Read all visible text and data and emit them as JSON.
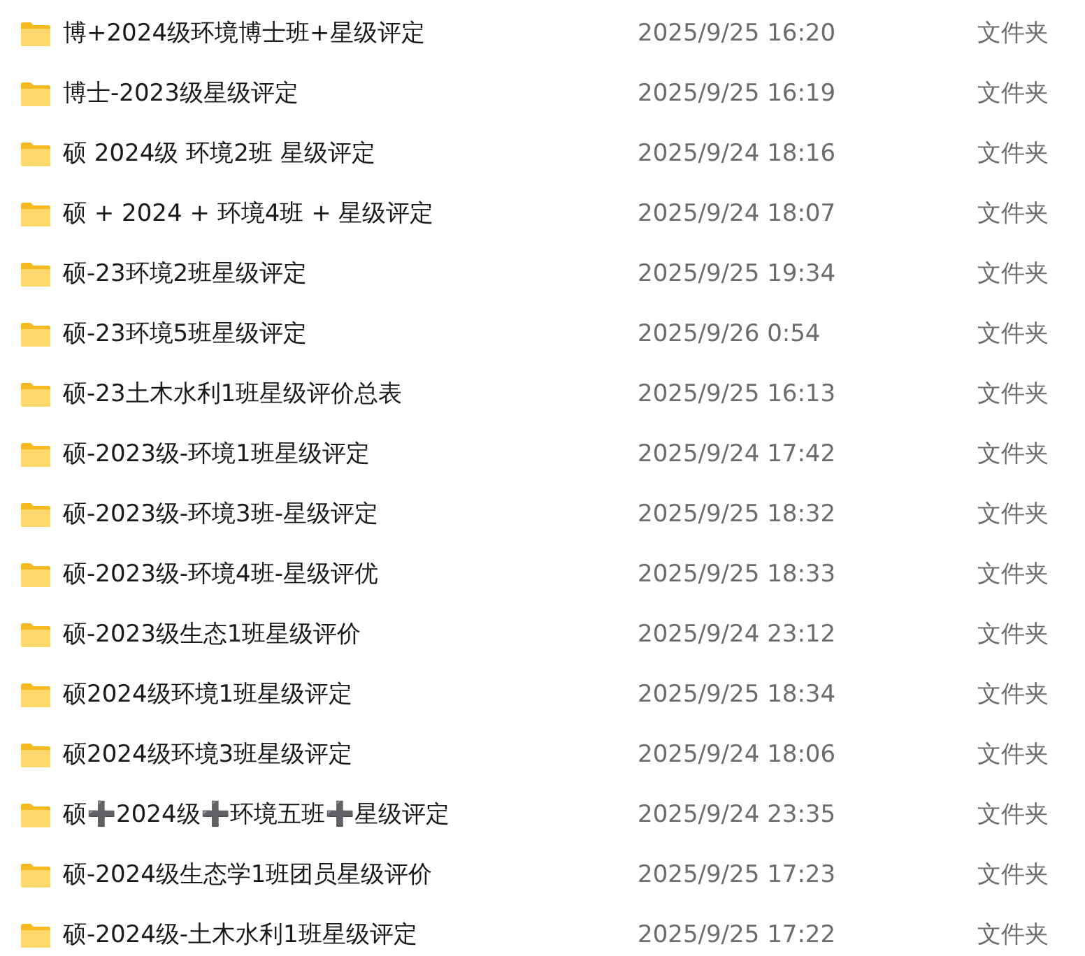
{
  "files": [
    {
      "name": "博+2024级环境博士班+星级评定",
      "modified": "2025/9/25 16:20",
      "type": "文件夹"
    },
    {
      "name": "博士-2023级星级评定",
      "modified": "2025/9/25 16:19",
      "type": "文件夹"
    },
    {
      "name": "硕 2024级 环境2班 星级评定",
      "modified": "2025/9/24 18:16",
      "type": "文件夹"
    },
    {
      "name": "硕 + 2024 + 环境4班 + 星级评定",
      "modified": "2025/9/24 18:07",
      "type": "文件夹"
    },
    {
      "name": "硕-23环境2班星级评定",
      "modified": "2025/9/25 19:34",
      "type": "文件夹"
    },
    {
      "name": "硕-23环境5班星级评定",
      "modified": "2025/9/26 0:54",
      "type": "文件夹"
    },
    {
      "name": "硕-23土木水利1班星级评价总表",
      "modified": "2025/9/25 16:13",
      "type": "文件夹"
    },
    {
      "name": "硕-2023级-环境1班星级评定",
      "modified": "2025/9/24 17:42",
      "type": "文件夹"
    },
    {
      "name": "硕-2023级-环境3班-星级评定",
      "modified": "2025/9/25 18:32",
      "type": "文件夹"
    },
    {
      "name": "硕-2023级-环境4班-星级评优",
      "modified": "2025/9/25 18:33",
      "type": "文件夹"
    },
    {
      "name": "硕-2023级生态1班星级评价",
      "modified": "2025/9/24 23:12",
      "type": "文件夹"
    },
    {
      "name": "硕2024级环境1班星级评定",
      "modified": "2025/9/25 18:34",
      "type": "文件夹"
    },
    {
      "name": "硕2024级环境3班星级评定",
      "modified": "2025/9/24 18:06",
      "type": "文件夹"
    },
    {
      "name": "硕➕2024级➕环境五班➕星级评定",
      "modified": "2025/9/24 23:35",
      "type": "文件夹"
    },
    {
      "name": "硕-2024级生态学1班团员星级评价",
      "modified": "2025/9/25 17:23",
      "type": "文件夹"
    },
    {
      "name": "硕-2024级-土木水利1班星级评定",
      "modified": "2025/9/25 17:22",
      "type": "文件夹"
    }
  ]
}
